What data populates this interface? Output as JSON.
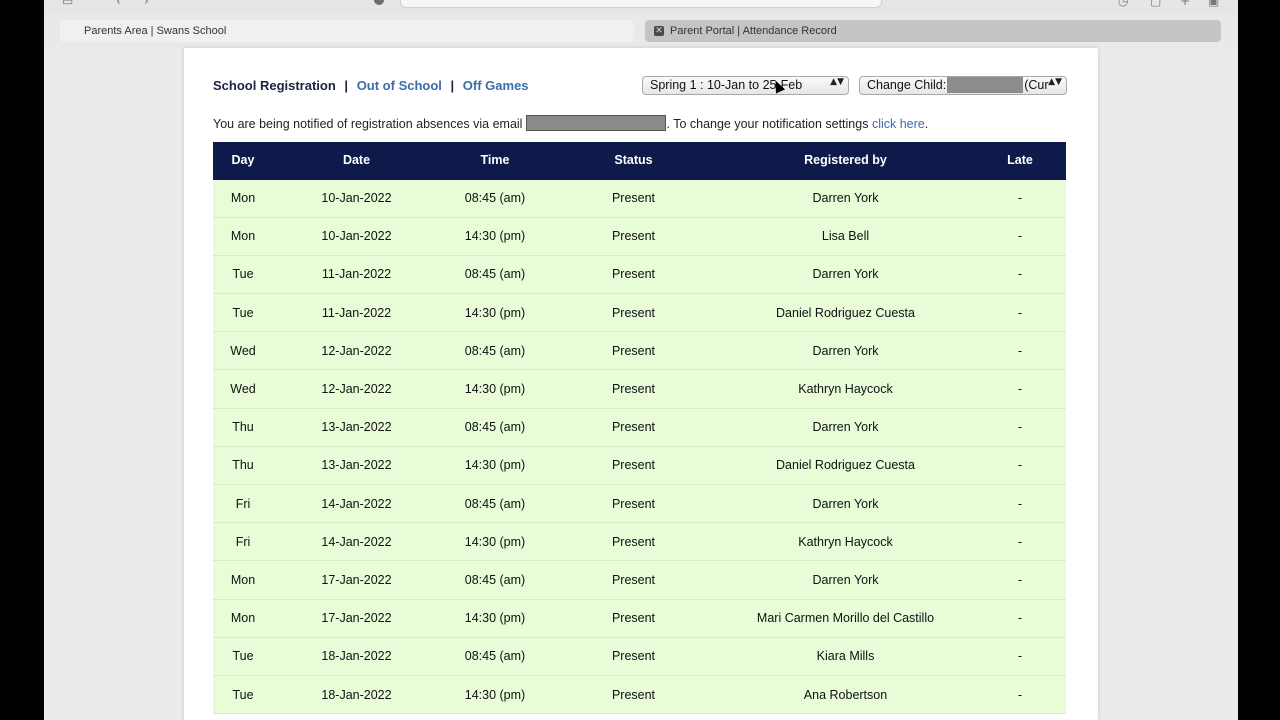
{
  "browser": {
    "tabs": [
      {
        "label": "Parents Area | Swans School"
      },
      {
        "label": "Parent Portal | Attendance Record",
        "close_glyph": "✕"
      }
    ]
  },
  "subnav": {
    "active": "School Registration",
    "links": [
      "Out of School",
      "Off Games"
    ],
    "separator": "|"
  },
  "term_select": {
    "value": "Spring 1 : 10-Jan to 25-Feb"
  },
  "child_select": {
    "label": "Change Child:",
    "suffix": "(Cur"
  },
  "select_arrows": "▲▼",
  "notice": {
    "prefix": "You are being notified of registration absences via email",
    "middle": ". To change your notification settings",
    "link": "click here",
    "end": "."
  },
  "table": {
    "headers": [
      "Day",
      "Date",
      "Time",
      "Status",
      "Registered by",
      "Late"
    ],
    "rows": [
      [
        "Mon",
        "10-Jan-2022",
        "08:45 (am)",
        "Present",
        "Darren York",
        "-"
      ],
      [
        "Mon",
        "10-Jan-2022",
        "14:30 (pm)",
        "Present",
        "Lisa Bell",
        "-"
      ],
      [
        "Tue",
        "11-Jan-2022",
        "08:45 (am)",
        "Present",
        "Darren York",
        "-"
      ],
      [
        "Tue",
        "11-Jan-2022",
        "14:30 (pm)",
        "Present",
        "Daniel Rodriguez Cuesta",
        "-"
      ],
      [
        "Wed",
        "12-Jan-2022",
        "08:45 (am)",
        "Present",
        "Darren York",
        "-"
      ],
      [
        "Wed",
        "12-Jan-2022",
        "14:30 (pm)",
        "Present",
        "Kathryn Haycock",
        "-"
      ],
      [
        "Thu",
        "13-Jan-2022",
        "08:45 (am)",
        "Present",
        "Darren York",
        "-"
      ],
      [
        "Thu",
        "13-Jan-2022",
        "14:30 (pm)",
        "Present",
        "Daniel Rodriguez Cuesta",
        "-"
      ],
      [
        "Fri",
        "14-Jan-2022",
        "08:45 (am)",
        "Present",
        "Darren York",
        "-"
      ],
      [
        "Fri",
        "14-Jan-2022",
        "14:30 (pm)",
        "Present",
        "Kathryn Haycock",
        "-"
      ],
      [
        "Mon",
        "17-Jan-2022",
        "08:45 (am)",
        "Present",
        "Darren York",
        "-"
      ],
      [
        "Mon",
        "17-Jan-2022",
        "14:30 (pm)",
        "Present",
        "Mari Carmen Morillo del Castillo",
        "-"
      ],
      [
        "Tue",
        "18-Jan-2022",
        "08:45 (am)",
        "Present",
        "Kiara Mills",
        "-"
      ],
      [
        "Tue",
        "18-Jan-2022",
        "14:30 (pm)",
        "Present",
        "Ana Robertson",
        "-"
      ]
    ]
  },
  "colors": {
    "header_bg": "#0e1a4a",
    "row_bg": "#e8fcd8",
    "link": "#3a6ea8"
  }
}
